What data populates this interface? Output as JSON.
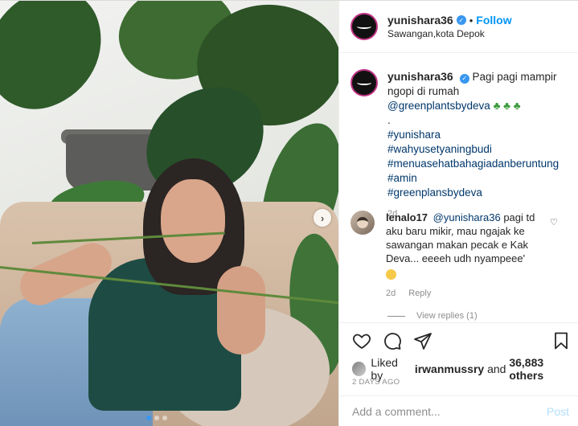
{
  "header": {
    "username": "yunishara36",
    "separator": "•",
    "follow_label": "Follow",
    "location": "Sawangan,kota Depok"
  },
  "caption": {
    "username": "yunishara36",
    "line1": "Pagi pagi mampir ngopi di rumah",
    "mention": "@greenplantsbydeva",
    "dot": ".",
    "hashtags": [
      "#yunishara",
      "#wahyusetyaningbudi",
      "#menuasehatbahagiadanberuntung",
      "#amin",
      "#greenplansbydeva"
    ],
    "age": "2d"
  },
  "comment": {
    "username": "lenalo17",
    "mention": "@yunishara36",
    "text": "pagi td aku baru mikir, mau ngajak ke sawangan makan pecak e Kak Deva... eeeeh udh nyampeee'",
    "age": "2d",
    "reply_label": "Reply"
  },
  "view_replies": "View replies (1)",
  "likes": {
    "prefix": "Liked by",
    "user": "irwanmussry",
    "and": "and",
    "others": "36,883 others"
  },
  "posted": "2 DAYS AGO",
  "add_comment": {
    "placeholder": "Add a comment...",
    "post_label": "Post"
  },
  "icons": {
    "verified": "verified-badge-icon",
    "like": "heart-icon",
    "comment": "comment-icon",
    "share": "paper-plane-icon",
    "save": "bookmark-icon",
    "next": "chevron-right-icon"
  },
  "colors": {
    "accent": "#0095f6",
    "link": "#00376b",
    "muted": "#8e8e8e"
  },
  "carousel": {
    "slides": 3,
    "active": 1
  }
}
